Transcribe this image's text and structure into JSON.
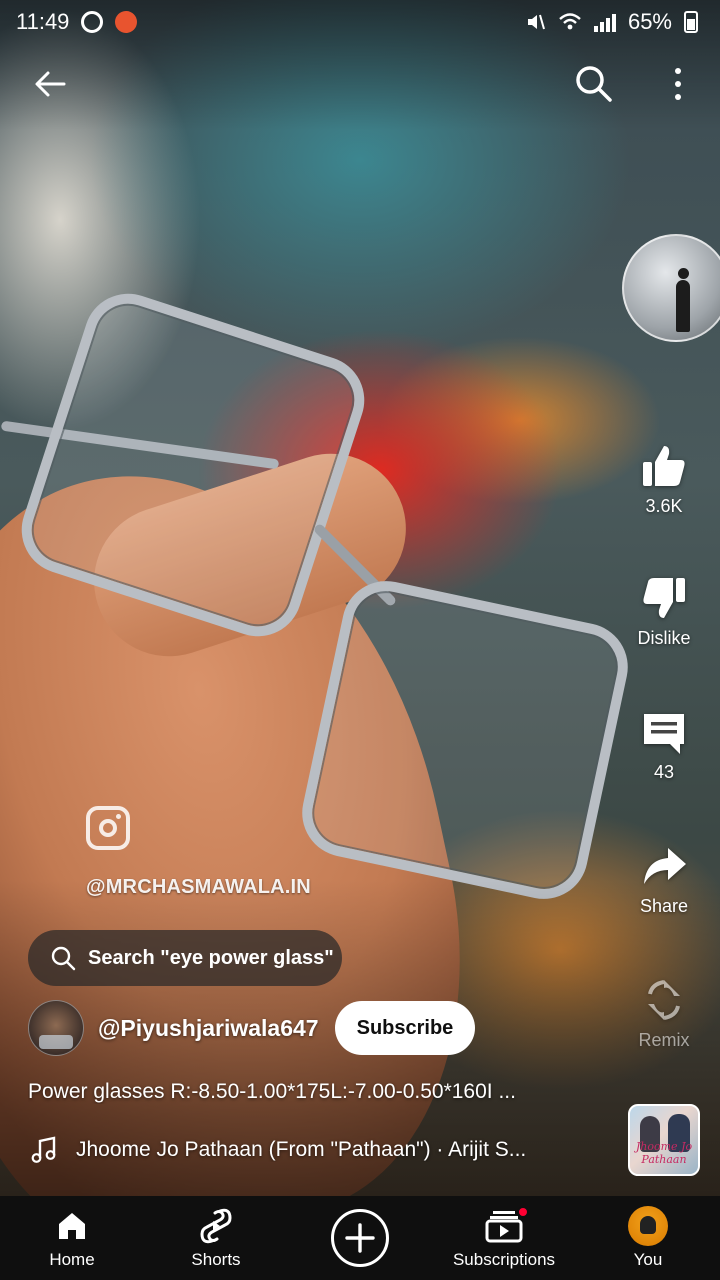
{
  "status_bar": {
    "time": "11:49",
    "battery": "65%"
  },
  "top_bar": {
    "back_icon": "arrow-left-icon",
    "search_icon": "search-icon",
    "more_icon": "more-vertical-icon"
  },
  "overlay": {
    "instagram_handle": "@MRCHASMAWALA.IN"
  },
  "search_suggestion": {
    "text": "Search \"eye power glass\""
  },
  "channel": {
    "handle": "@Piyushjariwala647",
    "subscribe_label": "Subscribe"
  },
  "description": "Power glasses R:-8.50-1.00*175L:-7.00-0.50*160I ...",
  "music": {
    "title": "Jhoome Jo Pathaan (From \"Pathaan\") · Arijit S..."
  },
  "actions": {
    "like_count": "3.6K",
    "dislike_label": "Dislike",
    "comment_count": "43",
    "share_label": "Share",
    "remix_label": "Remix"
  },
  "bottom_nav": {
    "items": [
      {
        "label": "Home",
        "icon": "home-icon"
      },
      {
        "label": "Shorts",
        "icon": "shorts-icon"
      },
      {
        "label": "",
        "icon": "create-plus-icon"
      },
      {
        "label": "Subscriptions",
        "icon": "subscriptions-icon"
      },
      {
        "label": "You",
        "icon": "avatar"
      }
    ]
  },
  "colors": {
    "nav_background": "#0f0f0f",
    "notification_dot": "#ff0033",
    "subscribe_bg": "#ffffff"
  }
}
